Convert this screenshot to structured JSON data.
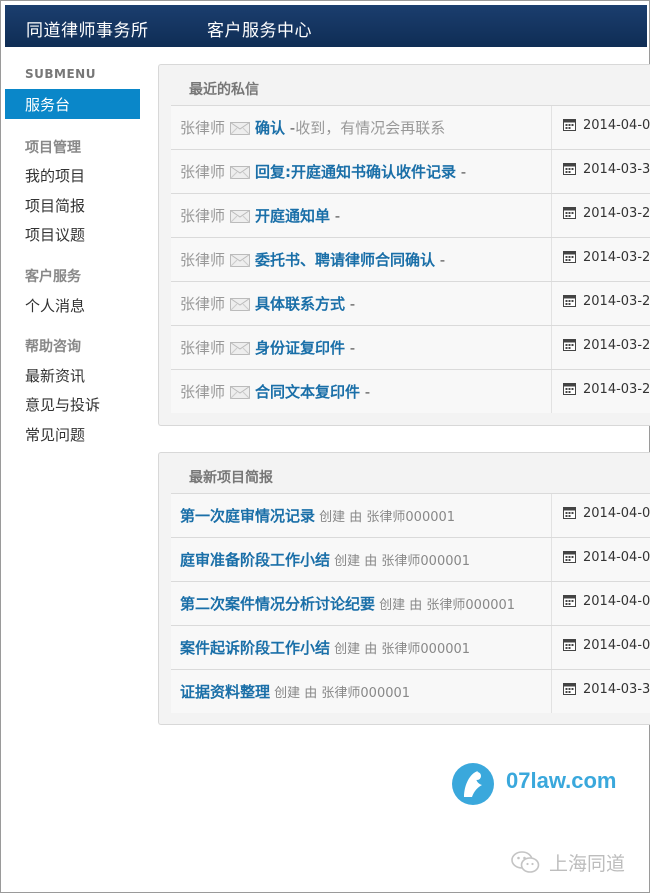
{
  "header": {
    "brand": "同道律师事务所",
    "nav_item": "客户服务中心"
  },
  "sidebar": {
    "title": "SUBMENU",
    "active": "服务台",
    "groups": [
      {
        "head": "项目管理",
        "items": [
          "我的项目",
          "项目简报",
          "项目议题"
        ]
      },
      {
        "head": "客户服务",
        "items": [
          "个人消息"
        ]
      },
      {
        "head": "帮助咨询",
        "items": [
          "最新资讯",
          "意见与投诉",
          "常见问题"
        ]
      }
    ]
  },
  "messages": {
    "title": "最近的私信",
    "rows": [
      {
        "sender": "张律师",
        "title": "确认",
        "dash": " -",
        "excerpt": "收到，有情况会再联系",
        "date": "2014-04-0"
      },
      {
        "sender": "张律师",
        "title": "回复:开庭通知书确认收件记录",
        "dash": " -",
        "excerpt": "",
        "date": "2014-03-3"
      },
      {
        "sender": "张律师",
        "title": "开庭通知单",
        "dash": " -",
        "excerpt": "",
        "date": "2014-03-2"
      },
      {
        "sender": "张律师",
        "title": "委托书、聘请律师合同确认",
        "dash": " -",
        "excerpt": "",
        "date": "2014-03-2"
      },
      {
        "sender": "张律师",
        "title": "具体联系方式",
        "dash": " -",
        "excerpt": "",
        "date": "2014-03-2"
      },
      {
        "sender": "张律师",
        "title": "身份证复印件",
        "dash": " -",
        "excerpt": "",
        "date": "2014-03-2"
      },
      {
        "sender": "张律师",
        "title": "合同文本复印件",
        "dash": " -",
        "excerpt": "",
        "date": "2014-03-2"
      }
    ]
  },
  "briefs": {
    "title": "最新项目简报",
    "rows": [
      {
        "title": "第一次庭审情况记录",
        "meta": " 创建 由 张律师000001",
        "date": "2014-04-0"
      },
      {
        "title": "庭审准备阶段工作小结",
        "meta": " 创建 由 张律师000001",
        "date": "2014-04-0"
      },
      {
        "title": "第二次案件情况分析讨论纪要",
        "meta": " 创建 由 张律师000001",
        "date": "2014-04-0"
      },
      {
        "title": "案件起诉阶段工作小结",
        "meta": " 创建 由 张律师000001",
        "date": "2014-04-0"
      },
      {
        "title": "证据资料整理",
        "meta": " 创建 由 张律师000001",
        "date": "2014-03-3"
      }
    ]
  },
  "watermark": {
    "site": "07law.com",
    "wechat": "上海同道"
  },
  "colors": {
    "header_bg": "#0f2d55",
    "active_bg": "#0a87c9",
    "link": "#1a6fa8"
  }
}
